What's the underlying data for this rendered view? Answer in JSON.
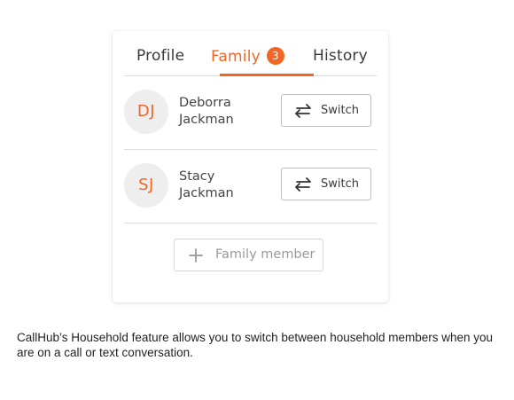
{
  "tabs": [
    {
      "label": "Profile"
    },
    {
      "label": "Family",
      "badge": "3",
      "active": true
    },
    {
      "label": "History"
    }
  ],
  "members": [
    {
      "initials": "DJ",
      "first_name": "Deborra",
      "last_name": "Jackman",
      "action_label": "Switch",
      "action_icon": "switch-arrows-icon"
    },
    {
      "initials": "SJ",
      "first_name": "Stacy",
      "last_name": "Jackman",
      "action_label": "Switch",
      "action_icon": "switch-arrows-icon"
    }
  ],
  "add_button": {
    "label": "Family member",
    "icon": "plus-icon"
  },
  "caption": "CallHub’s Household feature allows you to switch between household members when you are on a call or text conversation.",
  "colors": {
    "accent": "#f26522",
    "avatar_bg": "#eeeeee",
    "divider": "#dcdcdc",
    "text": "#3a3a3a"
  }
}
